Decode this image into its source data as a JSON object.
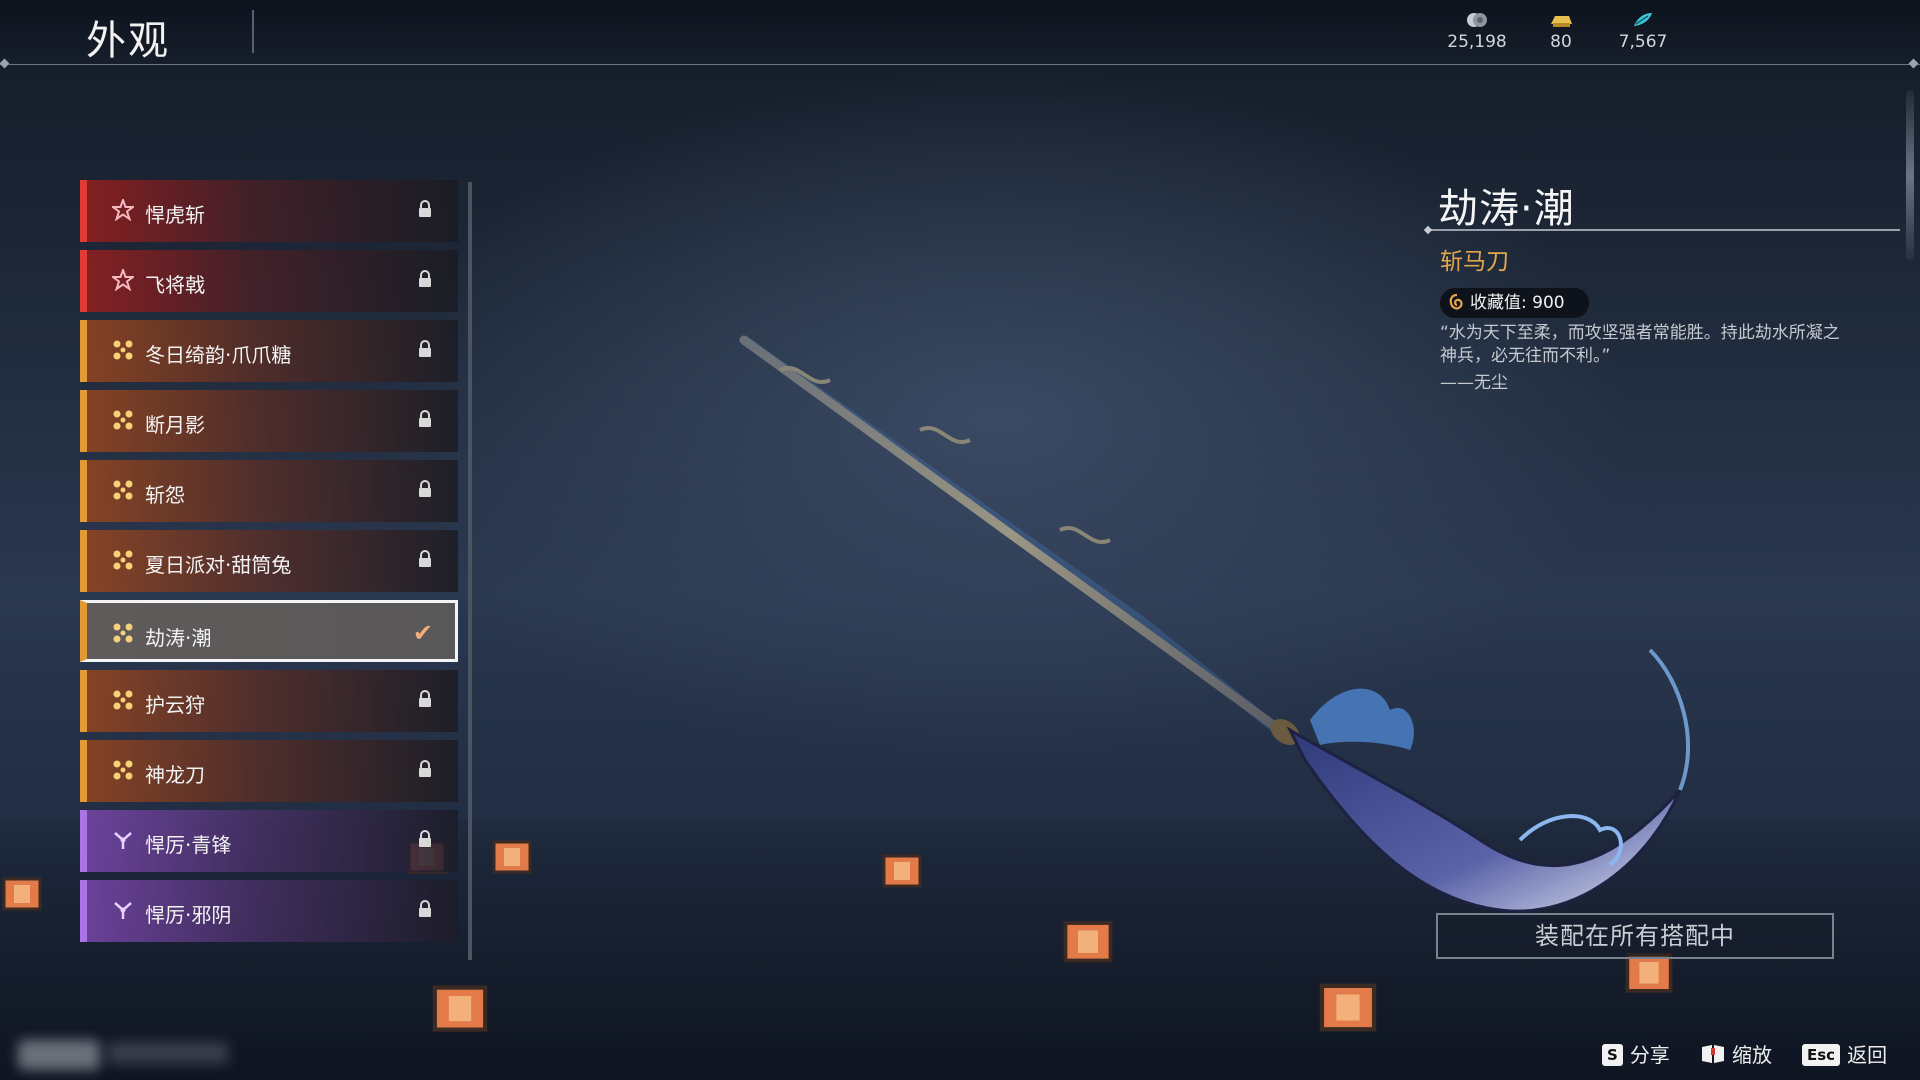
{
  "header": {
    "title": "外观",
    "currencies": [
      {
        "icon": "silver-coin-icon",
        "value": "25,198"
      },
      {
        "icon": "gold-ingot-icon",
        "value": "80"
      },
      {
        "icon": "feather-ticket-icon",
        "value": "7,567"
      }
    ]
  },
  "list": {
    "items": [
      {
        "label": "悍虎斩",
        "rarity": "red",
        "icon": "star-flower-icon",
        "status": "locked"
      },
      {
        "label": "飞将戟",
        "rarity": "red",
        "icon": "star-flower-icon",
        "status": "locked"
      },
      {
        "label": "冬日绮韵·爪爪糖",
        "rarity": "orange",
        "icon": "cross-flower-icon",
        "status": "locked"
      },
      {
        "label": "断月影",
        "rarity": "orange",
        "icon": "cross-flower-icon",
        "status": "locked"
      },
      {
        "label": "斩怨",
        "rarity": "orange",
        "icon": "cross-flower-icon",
        "status": "locked"
      },
      {
        "label": "夏日派对·甜筒兔",
        "rarity": "orange",
        "icon": "cross-flower-icon",
        "status": "locked"
      },
      {
        "label": "劫涛·潮",
        "rarity": "orange",
        "icon": "cross-flower-icon",
        "status": "selected"
      },
      {
        "label": "护云狩",
        "rarity": "orange",
        "icon": "cross-flower-icon",
        "status": "locked"
      },
      {
        "label": "神龙刀",
        "rarity": "orange",
        "icon": "cross-flower-icon",
        "status": "locked"
      },
      {
        "label": "悍厉·青锋",
        "rarity": "purple",
        "icon": "trefoil-icon",
        "status": "locked"
      },
      {
        "label": "悍厉·邪阴",
        "rarity": "purple",
        "icon": "trefoil-icon",
        "status": "locked"
      }
    ]
  },
  "detail": {
    "name": "劫涛·潮",
    "type": "斩马刀",
    "collection_label": "收藏值:",
    "collection_value": "900",
    "quote": "“水为天下至柔，而攻坚强者常能胜。持此劫水所凝之神兵，必无往而不利。”",
    "author": "——无尘",
    "equip_button": "装配在所有搭配中"
  },
  "hints": {
    "share": {
      "key": "S",
      "label": "分享"
    },
    "zoom": {
      "key_icon": "mouse-icon",
      "label": "缩放"
    },
    "back": {
      "key": "Esc",
      "label": "返回"
    }
  },
  "colors": {
    "red": "#e23a35",
    "orange": "#e29a35",
    "purple": "#a874e6",
    "gold_text": "#e3a64c"
  }
}
